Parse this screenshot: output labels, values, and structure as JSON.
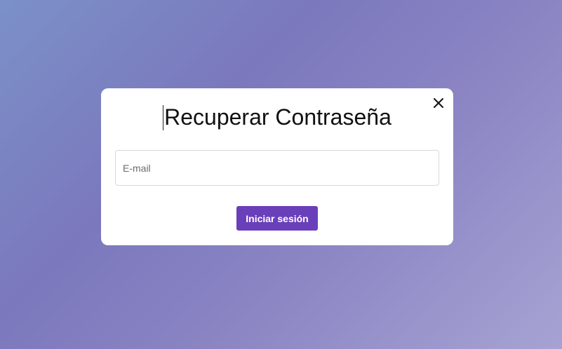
{
  "modal": {
    "title": "Recuperar Contraseña",
    "close_icon": "close-icon",
    "email": {
      "value": "",
      "placeholder": "E-mail"
    },
    "submit_label": "Iniciar sesión"
  },
  "colors": {
    "accent": "#6a3fba",
    "modal_background": "#ffffff",
    "background_gradient": [
      "#7b90c8",
      "#7b78bd",
      "#8a84c3",
      "#a6a3d3"
    ]
  }
}
